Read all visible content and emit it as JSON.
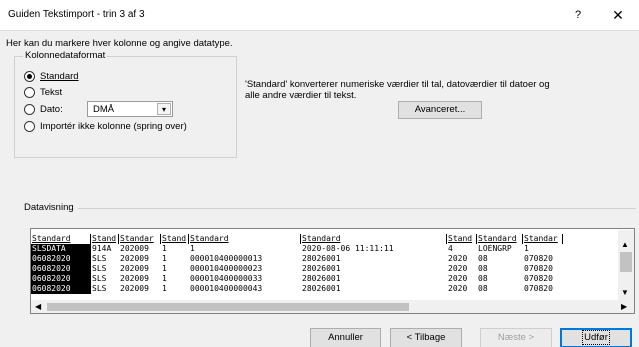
{
  "window": {
    "title": "Guiden Tekstimport - trin 3 af 3",
    "help_glyph": "?",
    "close_glyph": "✕"
  },
  "instruction": "Her kan du markere hver kolonne og angive datatype.",
  "column_format": {
    "legend": "Kolonnedataformat",
    "options": [
      {
        "label": "Standard",
        "selected": true
      },
      {
        "label": "Tekst",
        "selected": false
      },
      {
        "label": "Dato:",
        "selected": false
      },
      {
        "label": "Importér ikke kolonne (spring over)",
        "selected": false
      }
    ],
    "date_format": "DMÅ"
  },
  "description": {
    "line1": "'Standard' konverterer numeriske værdier til tal, datoværdier til datoer og",
    "line2": "alle andre værdier til tekst."
  },
  "advanced_button": "Avanceret...",
  "preview": {
    "label": "Datavisning",
    "columns": [
      "Standard",
      "Standard",
      "Standard",
      "Standard",
      "Standard",
      "Standard",
      "Standard",
      "Standard",
      "Standard"
    ],
    "header_texts": [
      "Standard",
      "Stand",
      "Standar",
      "Stand",
      "Standard",
      "Standard",
      "Stand",
      "Standard",
      "Standar"
    ],
    "rows": [
      [
        "SLSDATA",
        "914A",
        "202009",
        "1",
        "1",
        "2020-08-06 11:11:11",
        "4",
        "LOENGRP",
        "1"
      ],
      [
        "06082020",
        "SLS",
        "202009",
        "1",
        "000010400000013",
        "28026001",
        "2020",
        "08",
        "070820"
      ],
      [
        "06082020",
        "SLS",
        "202009",
        "1",
        "000010400000023",
        "28026001",
        "2020",
        "08",
        "070820"
      ],
      [
        "06082020",
        "SLS",
        "202009",
        "1",
        "000010400000033",
        "28026001",
        "2020",
        "08",
        "070820"
      ],
      [
        "06082020",
        "SLS",
        "202009",
        "1",
        "000010400000043",
        "28026001",
        "2020",
        "08",
        "070820"
      ]
    ]
  },
  "footer": {
    "cancel": "Annuller",
    "back": "< Tilbage",
    "next": "Næste >",
    "finish": "Udfør"
  },
  "colors": {
    "dialog_bg": "#f0f0f0",
    "selected_column": "#000000",
    "default_button_border": "#0078d7"
  }
}
